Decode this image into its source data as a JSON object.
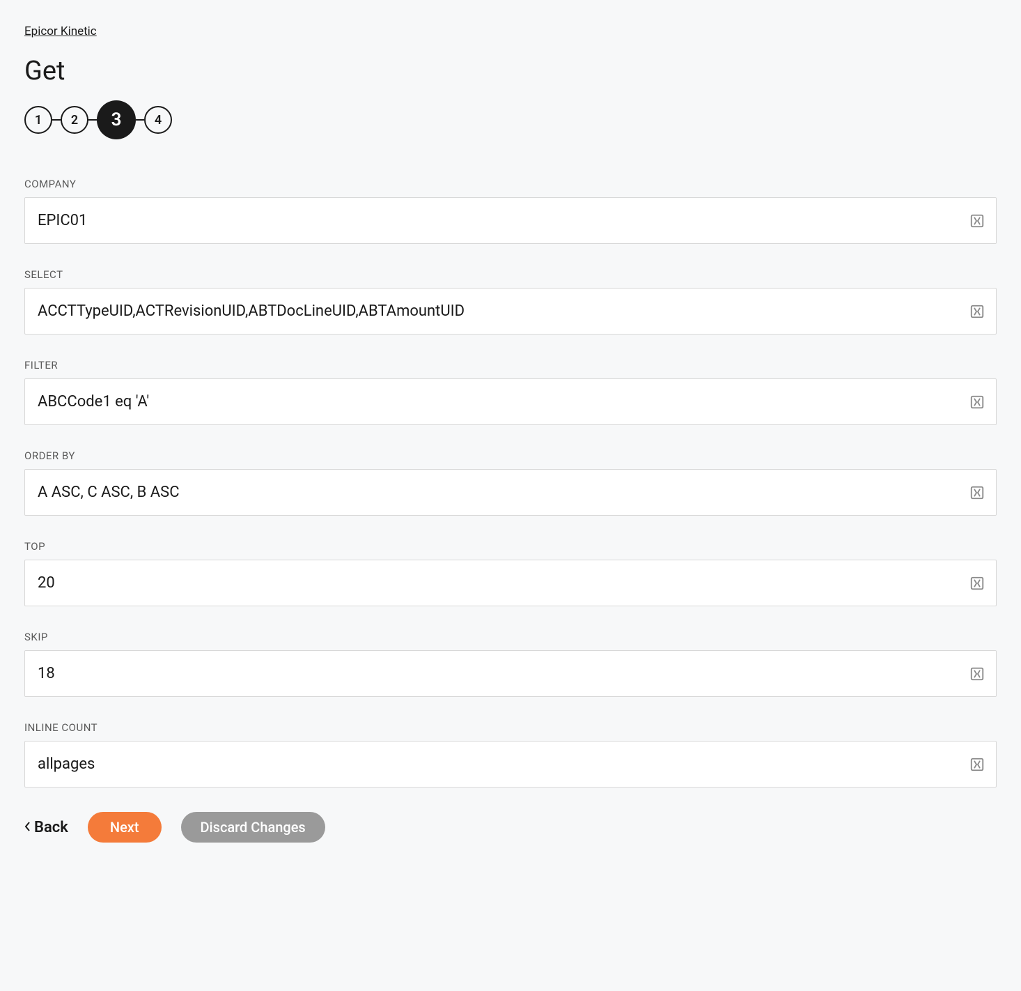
{
  "breadcrumb": "Epicor Kinetic",
  "page_title": "Get",
  "stepper": {
    "steps": [
      "1",
      "2",
      "3",
      "4"
    ],
    "active_index": 2
  },
  "fields": {
    "company": {
      "label": "COMPANY",
      "value": "EPIC01"
    },
    "select": {
      "label": "SELECT",
      "value": "ACCTTypeUID,ACTRevisionUID,ABTDocLineUID,ABTAmountUID"
    },
    "filter": {
      "label": "FILTER",
      "value": "ABCCode1 eq 'A'"
    },
    "orderby": {
      "label": "ORDER BY",
      "value": "A ASC, C ASC, B ASC"
    },
    "top": {
      "label": "TOP",
      "value": "20"
    },
    "skip": {
      "label": "SKIP",
      "value": "18"
    },
    "inlinecount": {
      "label": "INLINE COUNT",
      "value": "allpages"
    }
  },
  "buttons": {
    "back": "Back",
    "next": "Next",
    "discard": "Discard Changes"
  }
}
